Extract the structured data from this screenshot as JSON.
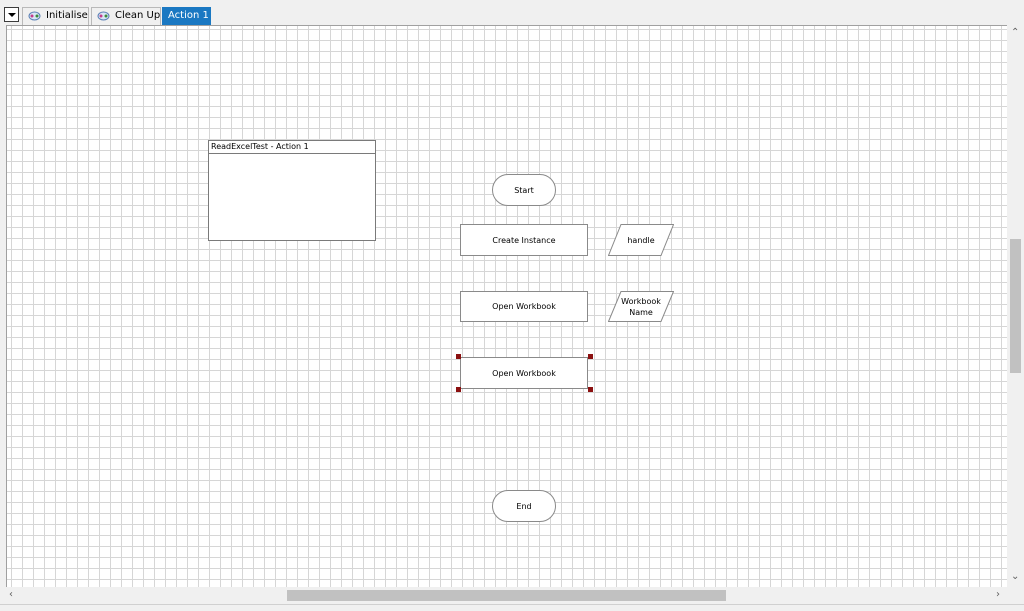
{
  "tabs": [
    {
      "label": "Initialise",
      "icon": "process-icon",
      "active": false
    },
    {
      "label": "Clean Up",
      "icon": "process-icon",
      "active": false
    },
    {
      "label": "Action 1",
      "active": true
    }
  ],
  "canvas": {
    "note_title": "ReadExcelTest - Action 1",
    "start_label": "Start",
    "end_label": "End",
    "create_instance_label": "Create Instance",
    "open_workbook_label_1": "Open Workbook",
    "open_workbook_label_2": "Open Workbook",
    "data_handle_label": "handle",
    "data_workbook_name_label": "Workbook Name"
  },
  "colors": {
    "accent_tab": "#1a78c2",
    "selection_handle": "#8b1010",
    "grid": "#d6d6d6"
  },
  "icons": {
    "tab_dropdown": "chevron-down-icon",
    "scroll_up": "chevron-up-icon",
    "scroll_down": "chevron-down-icon",
    "scroll_left": "chevron-left-icon",
    "scroll_right": "chevron-right-icon"
  }
}
